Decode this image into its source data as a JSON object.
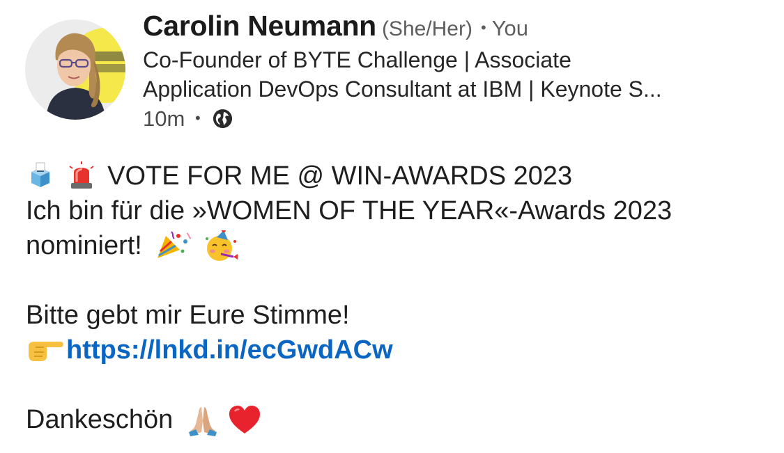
{
  "author": {
    "name": "Carolin Neumann",
    "pronouns": "(She/Her)",
    "you_label": "You",
    "headline_line1": "Co-Founder of BYTE Challenge | Associate",
    "headline_line2": "Application DevOps Consultant at IBM | Keynote S...",
    "time": "10m",
    "separator": "•",
    "visibility_icon": "globe-icon"
  },
  "post": {
    "line1": "VOTE FOR ME @ WIN-AWARDS 2023",
    "line2": "Ich bin für die »WOMEN OF THE YEAR«-Awards 2023",
    "line3": "nominiert!",
    "line4": "Bitte gebt mir Eure Stimme!",
    "link": "https://lnkd.in/ecGwdACw",
    "line6": "Dankeschön",
    "emoji_icons": [
      "ballot-box-icon",
      "police-light-icon",
      "party-popper-icon",
      "partying-face-icon",
      "pointing-finger-icon",
      "folded-hands-icon",
      "red-heart-icon"
    ]
  },
  "colors": {
    "link": "#0a66c2",
    "avatar_background": "#f5e84a"
  }
}
